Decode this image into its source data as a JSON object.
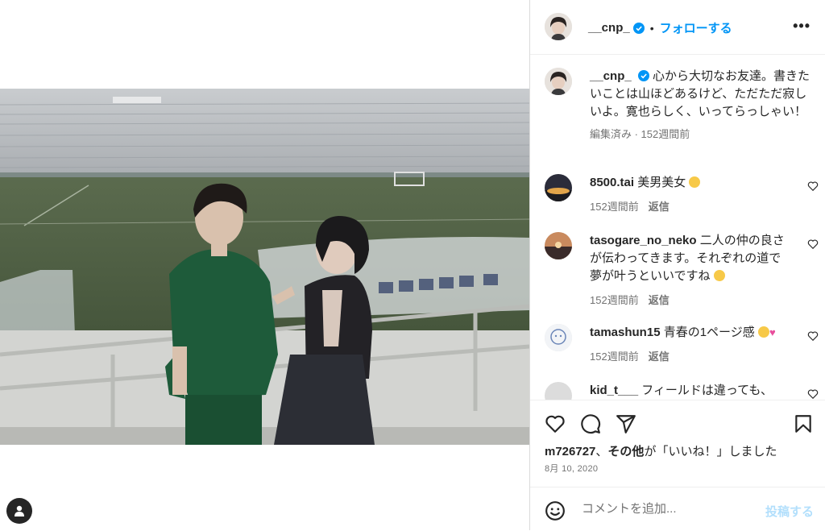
{
  "post": {
    "username": "__cnp_",
    "follow_label": "フォローする",
    "more_label": "•••",
    "caption": {
      "text": "心から大切なお友達。書きたいことは山ほどあるけど、ただただ寂しいよ。寛也らしく、いってらっしゃい！",
      "edited": "編集済み · 152週間前"
    },
    "comments": [
      {
        "username": "8500.tai",
        "text": "美男美女",
        "time": "152週間前",
        "reply": "返信",
        "emoji": "laugh"
      },
      {
        "username": "tasogare_no_neko",
        "text": "二人の仲の良さが伝わってきます。それぞれの道で夢が叶うといいですね",
        "time": "152週間前",
        "reply": "返信",
        "emoji": "smile"
      },
      {
        "username": "tamashun15",
        "text": "青春の1ページ感",
        "time": "152週間前",
        "reply": "返信",
        "emoji": "pleading-heart"
      },
      {
        "username": "kid_t___",
        "text": "フィールドは違っても、",
        "time": "",
        "reply": "",
        "emoji": ""
      }
    ],
    "likes": {
      "user": "m726727",
      "connector": "、",
      "others": "その他",
      "suffix": "が「いいね！」しました"
    },
    "date": "8月 10, 2020",
    "add_comment_placeholder": "コメントを追加...",
    "post_button": "投稿する"
  },
  "icons": {
    "verified": "verified-badge-icon",
    "heart": "heart-icon",
    "comment": "comment-icon",
    "share": "share-icon",
    "save": "bookmark-icon",
    "emoji": "emoji-icon",
    "tagged_user": "user-tag-icon"
  },
  "colors": {
    "accent": "#0095f6",
    "muted": "#737373",
    "verified": "#0095f6"
  }
}
